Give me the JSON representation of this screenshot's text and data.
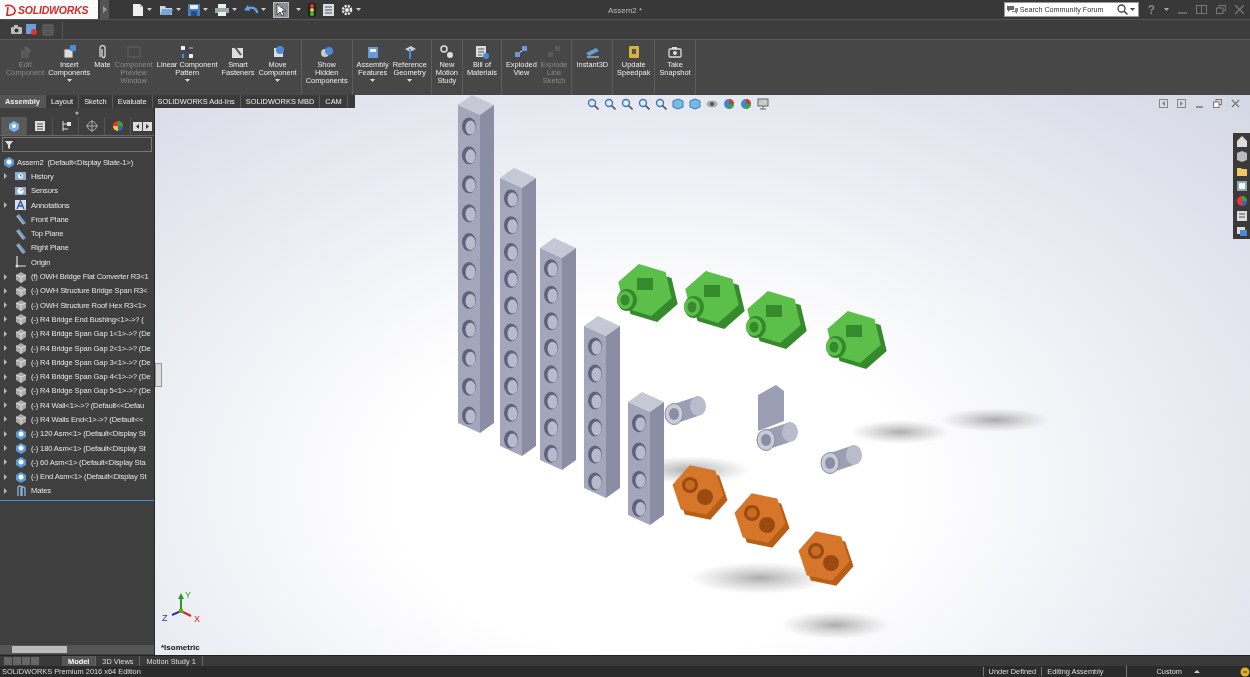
{
  "window": {
    "logo": "SOLIDWORKS",
    "title": "Assem2 *",
    "help": "?"
  },
  "search": {
    "placeholder": "Search Community Forum"
  },
  "command_groups": [
    {
      "commands": [
        {
          "label": "Edit\nComponent",
          "disabled": true,
          "dropdown": false
        },
        {
          "label": "Insert\nComponents",
          "disabled": false,
          "dropdown": true
        },
        {
          "label": "Mate",
          "disabled": false,
          "dropdown": false
        },
        {
          "label": "Component\nPreview\nWindow",
          "disabled": true,
          "dropdown": false
        },
        {
          "label": "Linear Component\nPattern",
          "disabled": false,
          "dropdown": true
        },
        {
          "label": "Smart\nFasteners",
          "disabled": false,
          "dropdown": false
        },
        {
          "label": "Move\nComponent",
          "disabled": false,
          "dropdown": true
        }
      ]
    },
    {
      "commands": [
        {
          "label": "Show\nHidden\nComponents",
          "disabled": false,
          "dropdown": false
        }
      ]
    },
    {
      "commands": [
        {
          "label": "Assembly\nFeatures",
          "disabled": false,
          "dropdown": true
        },
        {
          "label": "Reference\nGeometry",
          "disabled": false,
          "dropdown": true
        }
      ]
    },
    {
      "commands": [
        {
          "label": "New\nMotion\nStudy",
          "disabled": false,
          "dropdown": false
        }
      ]
    },
    {
      "commands": [
        {
          "label": "Bill of\nMaterials",
          "disabled": false,
          "dropdown": false
        }
      ]
    },
    {
      "commands": [
        {
          "label": "Exploded\nView",
          "disabled": false,
          "dropdown": false
        },
        {
          "label": "Explode\nLine\nSketch",
          "disabled": true,
          "dropdown": false
        }
      ]
    },
    {
      "commands": [
        {
          "label": "Instant3D",
          "disabled": false,
          "dropdown": false
        }
      ]
    },
    {
      "commands": [
        {
          "label": "Update\nSpeedpak",
          "disabled": false,
          "dropdown": false
        }
      ]
    },
    {
      "commands": [
        {
          "label": "Take\nSnapshot",
          "disabled": false,
          "dropdown": false
        }
      ]
    }
  ],
  "tabs": [
    {
      "label": "Assembly",
      "selected": true
    },
    {
      "label": "Layout",
      "selected": false
    },
    {
      "label": "Sketch",
      "selected": false
    },
    {
      "label": "Evaluate",
      "selected": false
    },
    {
      "label": "SOLIDWORKS Add-Ins",
      "selected": false
    },
    {
      "label": "SOLIDWORKS MBD",
      "selected": false
    },
    {
      "label": "CAM",
      "selected": false
    }
  ],
  "panel_tabs": [
    {
      "selected": true
    },
    {
      "selected": false
    },
    {
      "selected": false
    },
    {
      "selected": false
    },
    {
      "selected": false
    }
  ],
  "feature_tree": {
    "root": "Assem2  (Default<Display State-1>)",
    "items": [
      {
        "kind": "history",
        "label": "History",
        "expandable": true
      },
      {
        "kind": "sensors",
        "label": "Sensors",
        "expandable": false
      },
      {
        "kind": "annotations",
        "label": "Annotations",
        "expandable": true
      },
      {
        "kind": "plane",
        "label": "Front Plane",
        "expandable": false
      },
      {
        "kind": "plane",
        "label": "Top Plane",
        "expandable": false
      },
      {
        "kind": "plane",
        "label": "Right Plane",
        "expandable": false
      },
      {
        "kind": "origin",
        "label": "Origin",
        "expandable": false
      },
      {
        "kind": "part",
        "label": "(f) OWH Bridge Flat Converter R3<1",
        "expandable": true
      },
      {
        "kind": "part",
        "label": "(-) OWH Structure Bridge Span R3<",
        "expandable": true
      },
      {
        "kind": "part",
        "label": "(-) OWH Structure Roof Hex R3<1>",
        "expandable": true
      },
      {
        "kind": "part",
        "label": "(-) R4 Bridge End Bushing<1>->? (",
        "expandable": true
      },
      {
        "kind": "part",
        "label": "(-) R4 Bridge Span Gap 1<1>->? (De",
        "expandable": true
      },
      {
        "kind": "part",
        "label": "(-) R4 Bridge Span Gap 2<1>->? (De",
        "expandable": true
      },
      {
        "kind": "part",
        "label": "(-) R4 Bridge Span Gap 3<1>->? (De",
        "expandable": true
      },
      {
        "kind": "part",
        "label": "(-) R4 Bridge Span Gap 4<1>->? (De",
        "expandable": true
      },
      {
        "kind": "part",
        "label": "(-) R4 Bridge Span Gap 5<1>->? (De",
        "expandable": true
      },
      {
        "kind": "part",
        "label": "(-) R4 Wall<1>->? (Default<<Defau",
        "expandable": true
      },
      {
        "kind": "part",
        "label": "(-) R4 Walls End<1>->? (Default<<",
        "expandable": true
      },
      {
        "kind": "assembly",
        "label": "(-) 120 Asm<1> (Default<Display St",
        "expandable": true
      },
      {
        "kind": "assembly",
        "label": "(-) 180 Asm<1> (Default<Display St",
        "expandable": true
      },
      {
        "kind": "assembly",
        "label": "(-) 60 Asm<1> (Default<Display Sta",
        "expandable": true
      },
      {
        "kind": "assembly",
        "label": "(-) End Asm<1> (Default<Display St",
        "expandable": true
      },
      {
        "kind": "mates",
        "label": "Mates",
        "expandable": true
      }
    ]
  },
  "viewport": {
    "view_name": "*Isometric",
    "triad": {
      "x": "X",
      "y": "Y",
      "z": "Z"
    }
  },
  "bottom_tabs": [
    {
      "label": "Model",
      "selected": true
    },
    {
      "label": "3D Views",
      "selected": false
    },
    {
      "label": "Motion Study 1",
      "selected": false
    }
  ],
  "status_bar": {
    "product": "SOLIDWORKS Premium 2016 x64 Edition",
    "items": [
      "Under Defined",
      "Editing Assembly"
    ],
    "units": "Custom"
  }
}
